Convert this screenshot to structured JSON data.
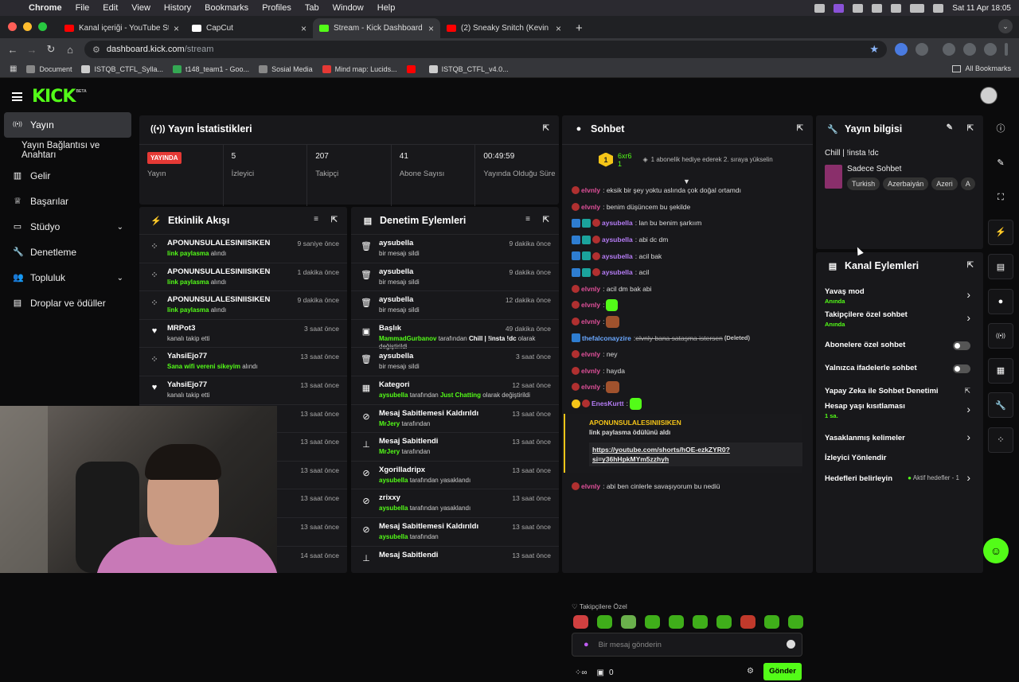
{
  "mac": {
    "app": "Chrome",
    "menus": [
      "File",
      "Edit",
      "View",
      "History",
      "Bookmarks",
      "Profiles",
      "Tab",
      "Window",
      "Help"
    ],
    "datetime": "Sat 11 Apr  18:05"
  },
  "tabs": [
    {
      "label": "Kanal içeriği - YouTube Studio",
      "color": "#ff0000"
    },
    {
      "label": "CapCut",
      "color": "#ffffff"
    },
    {
      "label": "Stream - Kick Dashboard",
      "color": "#53fc18"
    },
    {
      "label": "(2) Sneaky Snitch (Kevin MacLeod)",
      "color": "#ff0000"
    }
  ],
  "url": {
    "host": "dashboard.kick.com",
    "path": "/stream"
  },
  "bookmarks": [
    {
      "label": "Document",
      "color": "#888"
    },
    {
      "label": "ISTQB_CTFL_Sylla...",
      "color": "#ccc"
    },
    {
      "label": "t148_team1 - Goo...",
      "color": "#34a853"
    },
    {
      "label": "Sosial Media",
      "color": "#888"
    },
    {
      "label": "Mind map: Lucids...",
      "color": "#e53935"
    },
    {
      "label": "",
      "color": "#ff0000"
    },
    {
      "label": "ISTQB_CTFL_v4.0...",
      "color": "#ccc"
    }
  ],
  "all_bookmarks": "All Bookmarks",
  "kick": {
    "logo": "KICK",
    "beta": "BETA"
  },
  "sidebar": [
    {
      "label": "Yayın",
      "icon": "broadcast-icon",
      "active": true
    },
    {
      "label": "Yayın Bağlantısı ve Anahtarı",
      "sub": true
    },
    {
      "label": "Gelir",
      "icon": "chart-icon"
    },
    {
      "label": "Başarılar",
      "icon": "trophy-icon"
    },
    {
      "label": "Stüdyo",
      "icon": "studio-icon",
      "chev": true
    },
    {
      "label": "Denetleme",
      "icon": "wrench-icon"
    },
    {
      "label": "Topluluk",
      "icon": "users-icon",
      "chev": true
    },
    {
      "label": "Droplar ve ödüller",
      "icon": "drops-icon"
    }
  ],
  "stats": {
    "title": "Yayın İstatistikleri",
    "live_badge": "YAYINDA",
    "cells": [
      {
        "value": "",
        "label": "Yayın"
      },
      {
        "value": "5",
        "label": "İzleyici"
      },
      {
        "value": "207",
        "label": "Takipçi"
      },
      {
        "value": "41",
        "label": "Abone Sayısı"
      },
      {
        "value": "00:49:59",
        "label": "Yayında Olduğu Süre"
      }
    ]
  },
  "activity": {
    "title": "Etkinlik Akışı",
    "items": [
      {
        "icon": "reward-icon",
        "name": "APONUNSULALESINIISIKEN",
        "hl": "link paylasma",
        "rest": " alındı",
        "time": "9 saniye önce"
      },
      {
        "icon": "reward-icon",
        "name": "APONUNSULALESINIISIKEN",
        "hl": "link paylasma",
        "rest": " alındı",
        "time": "1 dakika önce"
      },
      {
        "icon": "reward-icon",
        "name": "APONUNSULALESINIISIKEN",
        "hl": "link paylasma",
        "rest": " alındı",
        "time": "9 dakika önce"
      },
      {
        "icon": "heart-icon",
        "name": "MRPot3",
        "hl": "",
        "rest": "kanalı takip etti",
        "time": "3 saat önce"
      },
      {
        "icon": "reward-icon",
        "name": "YahsiEjo77",
        "hl": "Sana wifi vereni sikeyim",
        "rest": " alındı",
        "time": "13 saat önce"
      },
      {
        "icon": "heart-icon",
        "name": "YahsiEjo77",
        "hl": "",
        "rest": "kanalı takip etti",
        "time": "13 saat önce"
      },
      {
        "icon": "",
        "name": "",
        "hl": "",
        "rest": "",
        "time": "13 saat önce"
      },
      {
        "icon": "",
        "name": "",
        "hl": "",
        "rest": "",
        "time": "13 saat önce"
      },
      {
        "icon": "",
        "name": "",
        "hl": "",
        "rest": "",
        "time": "13 saat önce"
      },
      {
        "icon": "",
        "name": "",
        "hl": "",
        "rest": "",
        "time": "13 saat önce"
      },
      {
        "icon": "",
        "name": "",
        "hl": "",
        "rest": "",
        "time": "13 saat önce"
      },
      {
        "icon": "",
        "name": "",
        "hl": "",
        "rest": "",
        "time": "14 saat önce"
      }
    ]
  },
  "moderation": {
    "title": "Denetim Eylemleri",
    "items": [
      {
        "icon": "trash-icon",
        "name": "aysubella",
        "pre": "",
        "hl": "",
        "mid": "bir mesajı sildi",
        "b": "",
        "post": "",
        "time": "9 dakika önce"
      },
      {
        "icon": "trash-icon",
        "name": "aysubella",
        "pre": "",
        "hl": "",
        "mid": "bir mesajı sildi",
        "b": "",
        "post": "",
        "time": "9 dakika önce"
      },
      {
        "icon": "trash-icon",
        "name": "aysubella",
        "pre": "",
        "hl": "",
        "mid": "bir mesajı sildi",
        "b": "",
        "post": "",
        "time": "12 dakika önce"
      },
      {
        "icon": "title-icon",
        "name": "Başlık",
        "pre": "",
        "hl": "MammadGurbanov",
        "mid": " tarafından ",
        "b": "Chill | !insta !dc",
        "post": " olarak değiştirildi",
        "time": "49 dakika önce"
      },
      {
        "icon": "trash-icon",
        "name": "aysubella",
        "pre": "",
        "hl": "",
        "mid": "bir mesajı sildi",
        "b": "",
        "post": "",
        "time": "3 saat önce"
      },
      {
        "icon": "category-icon",
        "name": "Kategori",
        "pre": "",
        "hl": "aysubella",
        "mid": " tarafından ",
        "b": "Just Chatting",
        "post": " olarak değiştirildi",
        "time": "12 saat önce",
        "bgreen": true
      },
      {
        "icon": "unpin-icon",
        "name": "Mesaj Sabitlemesi Kaldırıldı",
        "pre": "",
        "hl": "MrJery",
        "mid": " tarafından",
        "b": "",
        "post": "",
        "time": "13 saat önce"
      },
      {
        "icon": "pin-icon",
        "name": "Mesaj Sabitlendi",
        "pre": "",
        "hl": "MrJery",
        "mid": " tarafından",
        "b": "",
        "post": "",
        "time": "13 saat önce"
      },
      {
        "icon": "ban-icon",
        "name": "Xgorilladripx",
        "pre": "",
        "hl": "aysubella",
        "mid": " tarafından yasaklandı",
        "b": "",
        "post": "",
        "time": "13 saat önce"
      },
      {
        "icon": "ban-icon",
        "name": "zrixxy",
        "pre": "",
        "hl": "aysubella",
        "mid": " tarafından yasaklandı",
        "b": "",
        "post": "",
        "time": "13 saat önce"
      },
      {
        "icon": "unpin-icon",
        "name": "Mesaj Sabitlemesi Kaldırıldı",
        "pre": "",
        "hl": "aysubella",
        "mid": " tarafından",
        "b": "",
        "post": "",
        "time": "13 saat önce"
      },
      {
        "icon": "pin-icon",
        "name": "Mesaj Sabitlendi",
        "pre": "",
        "hl": "",
        "mid": "",
        "b": "",
        "post": "",
        "time": "13 saat önce"
      }
    ]
  },
  "chat": {
    "title": "Sohbet",
    "goal_name": "6xr6",
    "goal_count": "1",
    "gift_text": "1 abonelik hediye ederek 2. sıraya yükselin",
    "level": "1",
    "messages": [
      {
        "user": "elvnly",
        "color": "#e0509a",
        "badges": [
          "r"
        ],
        "text": ": eksik bir şey yoktu aslında çok doğal ortamdı"
      },
      {
        "user": "elvnly",
        "color": "#e0509a",
        "badges": [
          "r"
        ],
        "text": ": benim düşüncem bu şekilde"
      },
      {
        "user": "aysubella",
        "color": "#b57cf5",
        "badges": [
          "b",
          "t",
          "r"
        ],
        "text": ": lan bu benim şarkıım"
      },
      {
        "user": "aysubella",
        "color": "#b57cf5",
        "badges": [
          "b",
          "t",
          "r"
        ],
        "text": ": abi dc dm"
      },
      {
        "user": "aysubella",
        "color": "#b57cf5",
        "badges": [
          "b",
          "t",
          "r"
        ],
        "text": ": acil bak"
      },
      {
        "user": "aysubella",
        "color": "#b57cf5",
        "badges": [
          "b",
          "t",
          "r"
        ],
        "text": ": acil"
      },
      {
        "user": "elvnly",
        "color": "#e0509a",
        "badges": [
          "r"
        ],
        "text": ": acil dm bak abi"
      },
      {
        "user": "elvnly",
        "color": "#e0509a",
        "badges": [
          "r"
        ],
        "text": ":",
        "emote": "green"
      },
      {
        "user": "elvnly",
        "color": "#e0509a",
        "badges": [
          "r"
        ],
        "text": ":",
        "emote": "pic"
      },
      {
        "user": "thefalconayzire",
        "color": "#6aa8ff",
        "badges": [
          "b"
        ],
        "text": ": ",
        "deleted": "elvnly bana sataşma istersen",
        "deleted_tag": "(Deleted)"
      },
      {
        "user": "elvnly",
        "color": "#e0509a",
        "badges": [
          "r"
        ],
        "text": ": ney"
      },
      {
        "user": "elvnly",
        "color": "#e0509a",
        "badges": [
          "r"
        ],
        "text": ": hayda"
      },
      {
        "user": "elvnly",
        "color": "#e0509a",
        "badges": [
          "r"
        ],
        "text": ":",
        "emote": "pic"
      },
      {
        "user": "EnesKurtt",
        "color": "#b57cf5",
        "badges": [
          "y",
          "r"
        ],
        "text": ":",
        "emote": "green"
      }
    ],
    "reward": {
      "user": "APONUNSULALESINIISIKEN",
      "text": "link paylasma ödülünü aldı",
      "link": "https://youtube.com/shorts/hOE-ezkZYR0?si=y36hHpkMYm5zzhyh"
    },
    "last": {
      "user": "elvnly",
      "text": ": abi ben cinlerle savaşıyorum bu nediü"
    },
    "followers_only": "Takipçilere Özel",
    "placeholder": "Bir mesaj gönderin",
    "points": "0",
    "send": "Gönder"
  },
  "info": {
    "title": "Yayın bilgisi",
    "stream_title": "Chill | !insta !dc",
    "category": "Sadece Sohbet",
    "tags": [
      "Turkish",
      "Azerbaiyán",
      "Azeri",
      "A"
    ]
  },
  "actions": {
    "title": "Kanal Eylemleri",
    "items": [
      {
        "label": "Yavaş mod",
        "status": "Anında",
        "type": "arrow"
      },
      {
        "label": "Takipçilere özel sohbet",
        "status": "Anında",
        "type": "arrow"
      },
      {
        "label": "Abonelere özel sohbet",
        "status": "",
        "type": "toggle"
      },
      {
        "label": "Yalnızca ifadelerle sohbet",
        "status": "",
        "type": "toggle"
      },
      {
        "label": "Yapay Zeka ile Sohbet Denetimi",
        "status": "",
        "type": "ext"
      },
      {
        "label": "Hesap yaşı kısıtlaması",
        "status": "1 sa.",
        "type": "arrow"
      },
      {
        "label": "Yasaklanmış kelimeler",
        "status": "",
        "type": "arrow"
      },
      {
        "label": "İzleyici Yönlendir",
        "status": "",
        "type": "none"
      },
      {
        "label": "Hedefleri belirleyin",
        "status": "",
        "type": "goal",
        "extra": "Aktif hedefler - 1"
      }
    ]
  },
  "rail": [
    {
      "icon": "info-icon"
    },
    {
      "icon": "pencil-icon"
    },
    {
      "icon": "screen-icon"
    },
    {
      "icon": "bolt-icon"
    },
    {
      "icon": "list-icon"
    },
    {
      "icon": "chat-icon"
    },
    {
      "icon": "broadcast-icon"
    },
    {
      "icon": "calendar-icon"
    },
    {
      "icon": "wrench-icon"
    },
    {
      "icon": "reward-icon"
    }
  ]
}
